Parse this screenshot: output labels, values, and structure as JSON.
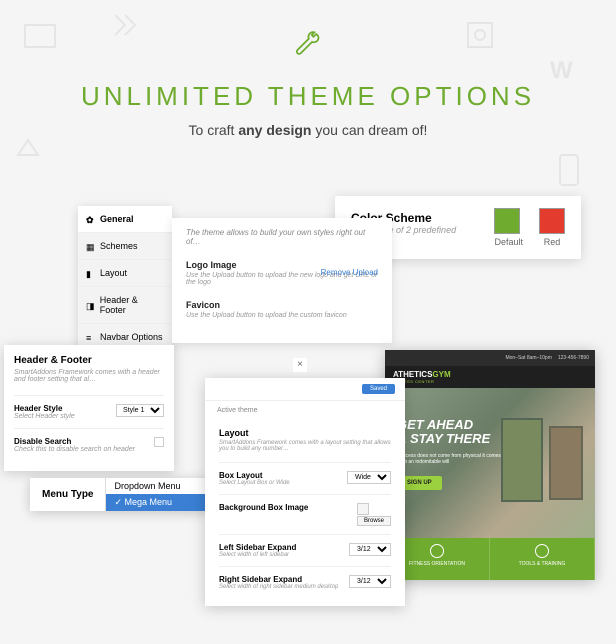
{
  "header": {
    "title": "UNLIMITED THEME OPTIONS",
    "subtitle_pre": "To craft ",
    "subtitle_bold": "any design",
    "subtitle_post": " you can dream of!"
  },
  "tabs": {
    "items": [
      {
        "label": "General",
        "active": true
      },
      {
        "label": "Schemes",
        "active": false
      },
      {
        "label": "Layout",
        "active": false
      },
      {
        "label": "Header & Footer",
        "active": false
      },
      {
        "label": "Navbar Options",
        "active": false
      }
    ]
  },
  "main": {
    "intro": "The theme allows to build your own styles right out of…",
    "logo": {
      "title": "Logo Image",
      "desc": "Use the Upload button to upload the new logo and get URL of the logo",
      "link": "Remove Upload"
    },
    "favicon": {
      "title": "Favicon",
      "desc": "Use the Upload button to upload the custom favicon"
    }
  },
  "hf": {
    "title": "Header & Footer",
    "note": "SmartAddons Framework comes with a header and footer setting that al…",
    "style": {
      "label": "Header Style",
      "desc": "Select Header style",
      "value": "Style 1"
    },
    "search": {
      "label": "Disable Search",
      "desc": "Check this to disable search on header"
    }
  },
  "menu": {
    "label": "Menu Type",
    "options": [
      "Dropdown Menu",
      "Mega Menu"
    ],
    "selected": "Mega Menu"
  },
  "color": {
    "title": "Color Scheme",
    "desc": "Select one of 2 predefined schemes",
    "swatches": [
      {
        "name": "Default"
      },
      {
        "name": "Red"
      }
    ]
  },
  "preview": {
    "topbar": {
      "hours": "Mon–Sat 8am–10pm",
      "phone": "123-456-7890"
    },
    "logo_a": "ATHETICS",
    "logo_b": "GYM",
    "logo_sub": "FITNESS CENTER",
    "hero_l1": "GET AHEAD",
    "hero_l2": "& STAY THERE",
    "hero_p": "Success does not come from physical it comes from an indomitable will",
    "cta": "SIGN UP",
    "footer": [
      "FITNESS ORIENTATION",
      "TOOLS & TRAINING"
    ]
  },
  "layout": {
    "saved": "Saved",
    "active_theme": "Active theme",
    "title": "Layout",
    "note": "SmartAddons Framework comes with a layout setting that allows you to build any number…",
    "box": {
      "label": "Box Layout",
      "desc": "Select Layout Box or Wide",
      "value": "Wide"
    },
    "bg": {
      "label": "Background Box Image",
      "browse": "Browse"
    },
    "left": {
      "label": "Left Sidebar Expand",
      "desc": "Select width of left sidebar",
      "value": "3/12"
    },
    "right": {
      "label": "Right Sidebar Expand",
      "desc": "Select width of right sidebar medium desktop",
      "value": "3/12"
    }
  }
}
